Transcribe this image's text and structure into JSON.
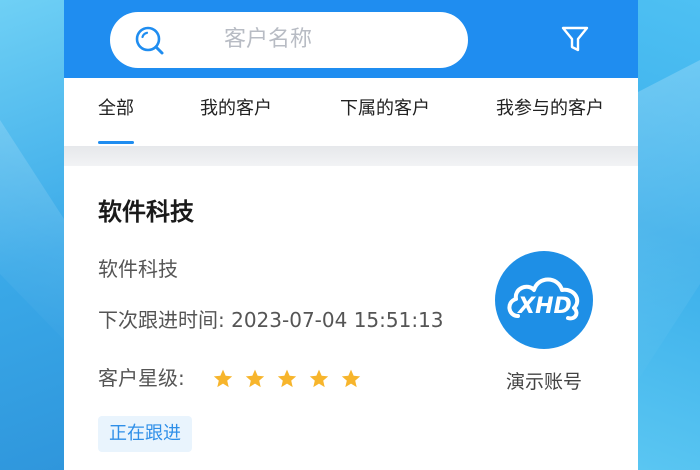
{
  "search": {
    "placeholder": "客户名称"
  },
  "tabs": [
    {
      "label": "全部",
      "active": true
    },
    {
      "label": "我的客户",
      "active": false
    },
    {
      "label": "下属的客户",
      "active": false
    },
    {
      "label": "我参与的客户",
      "active": false
    }
  ],
  "customer_card": {
    "title": "软件科技",
    "name": "软件科技",
    "next_followup_label": "下次跟进时间:",
    "next_followup_value": "2023-07-04 15:51:13",
    "rating_label": "客户星级:",
    "rating_stars": 5,
    "status": "正在跟进",
    "logo_text": "XHD",
    "logo_caption": "演示账号"
  },
  "colors": {
    "primary": "#1f8df0",
    "star": "#f7b52c",
    "status_text": "#2f8fe8",
    "status_bg": "#e9f4fd"
  },
  "icons": {
    "search": "search-icon",
    "filter": "filter-icon",
    "star": "star-icon",
    "logo": "cloud-logo-icon"
  }
}
